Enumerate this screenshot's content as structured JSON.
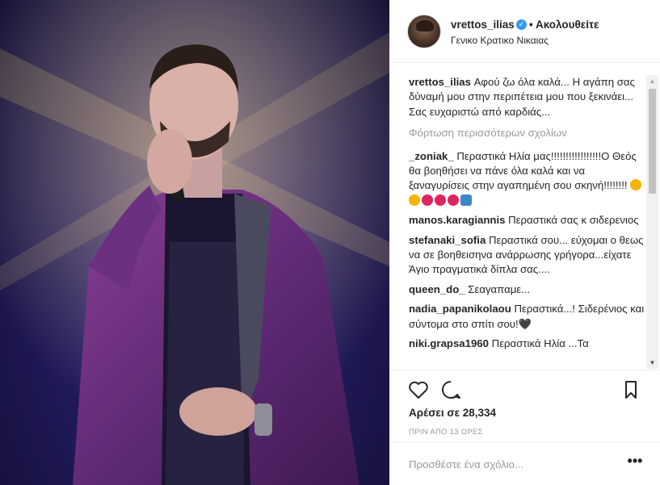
{
  "header": {
    "username": "vrettos_ilias",
    "follow_label": "• Ακολουθείτε",
    "location": "Γενικο Κρατικο Νικαιας"
  },
  "post": {
    "caption_user": "vrettos_ilias",
    "caption_text": "Αφού ζω όλα καλά... Η αγάπη σας δύναμή μου στην περιπέτεια μου που ξεκινάει... Σας ευχαριστώ από καρδιάς..."
  },
  "load_more_label": "Φόρτωση περισσότερων σχολίων",
  "comments": [
    {
      "user": "_zoniak_",
      "text": "Περαστικά Ηλία μας!!!!!!!!!!!!!!!!!Ο Θεός θα βοηθήσει να πάνε όλα καλά και να ξαναγυρίσεις στην αγαπημένη σου σκηνή!!!!!!!!"
    },
    {
      "user": "manos.karagiannis",
      "text": "Περαστικά σας κ σιδερενιος"
    },
    {
      "user": "stefanaki_sofia",
      "text": "Περαστικά σου... εύχομαι ο θεως να σε βοηθεισηνα ανάρρωσης γρήγορα...είχατε Άγιο πραγματικά δίπλα σας...."
    },
    {
      "user": "queen_do_",
      "text": "Σεαγαπαμε..."
    },
    {
      "user": "nadia_papanikolaou",
      "text": "Περαστικά...! Σιδερένιος και σύντομα στο σπίτι σου!🖤"
    },
    {
      "user": "niki.grapsa1960",
      "text": "Περαστικά Ηλία ...Τα"
    }
  ],
  "emoji_row": [
    "#f4b400",
    "#f4b400",
    "#e0245e",
    "#e0245e",
    "#e0245e",
    "#3b88c3"
  ],
  "likes_label": "Αρέσει σε 28,334",
  "time_label": "ΠΡΙΝ ΑΠΟ 13 ΩΡΕΣ",
  "add_comment_placeholder": "Προσθέστε ένα σχόλιο...",
  "more_label": "•••",
  "colors": {
    "verified": "#3897f0",
    "muted": "#999999",
    "text": "#262626"
  }
}
